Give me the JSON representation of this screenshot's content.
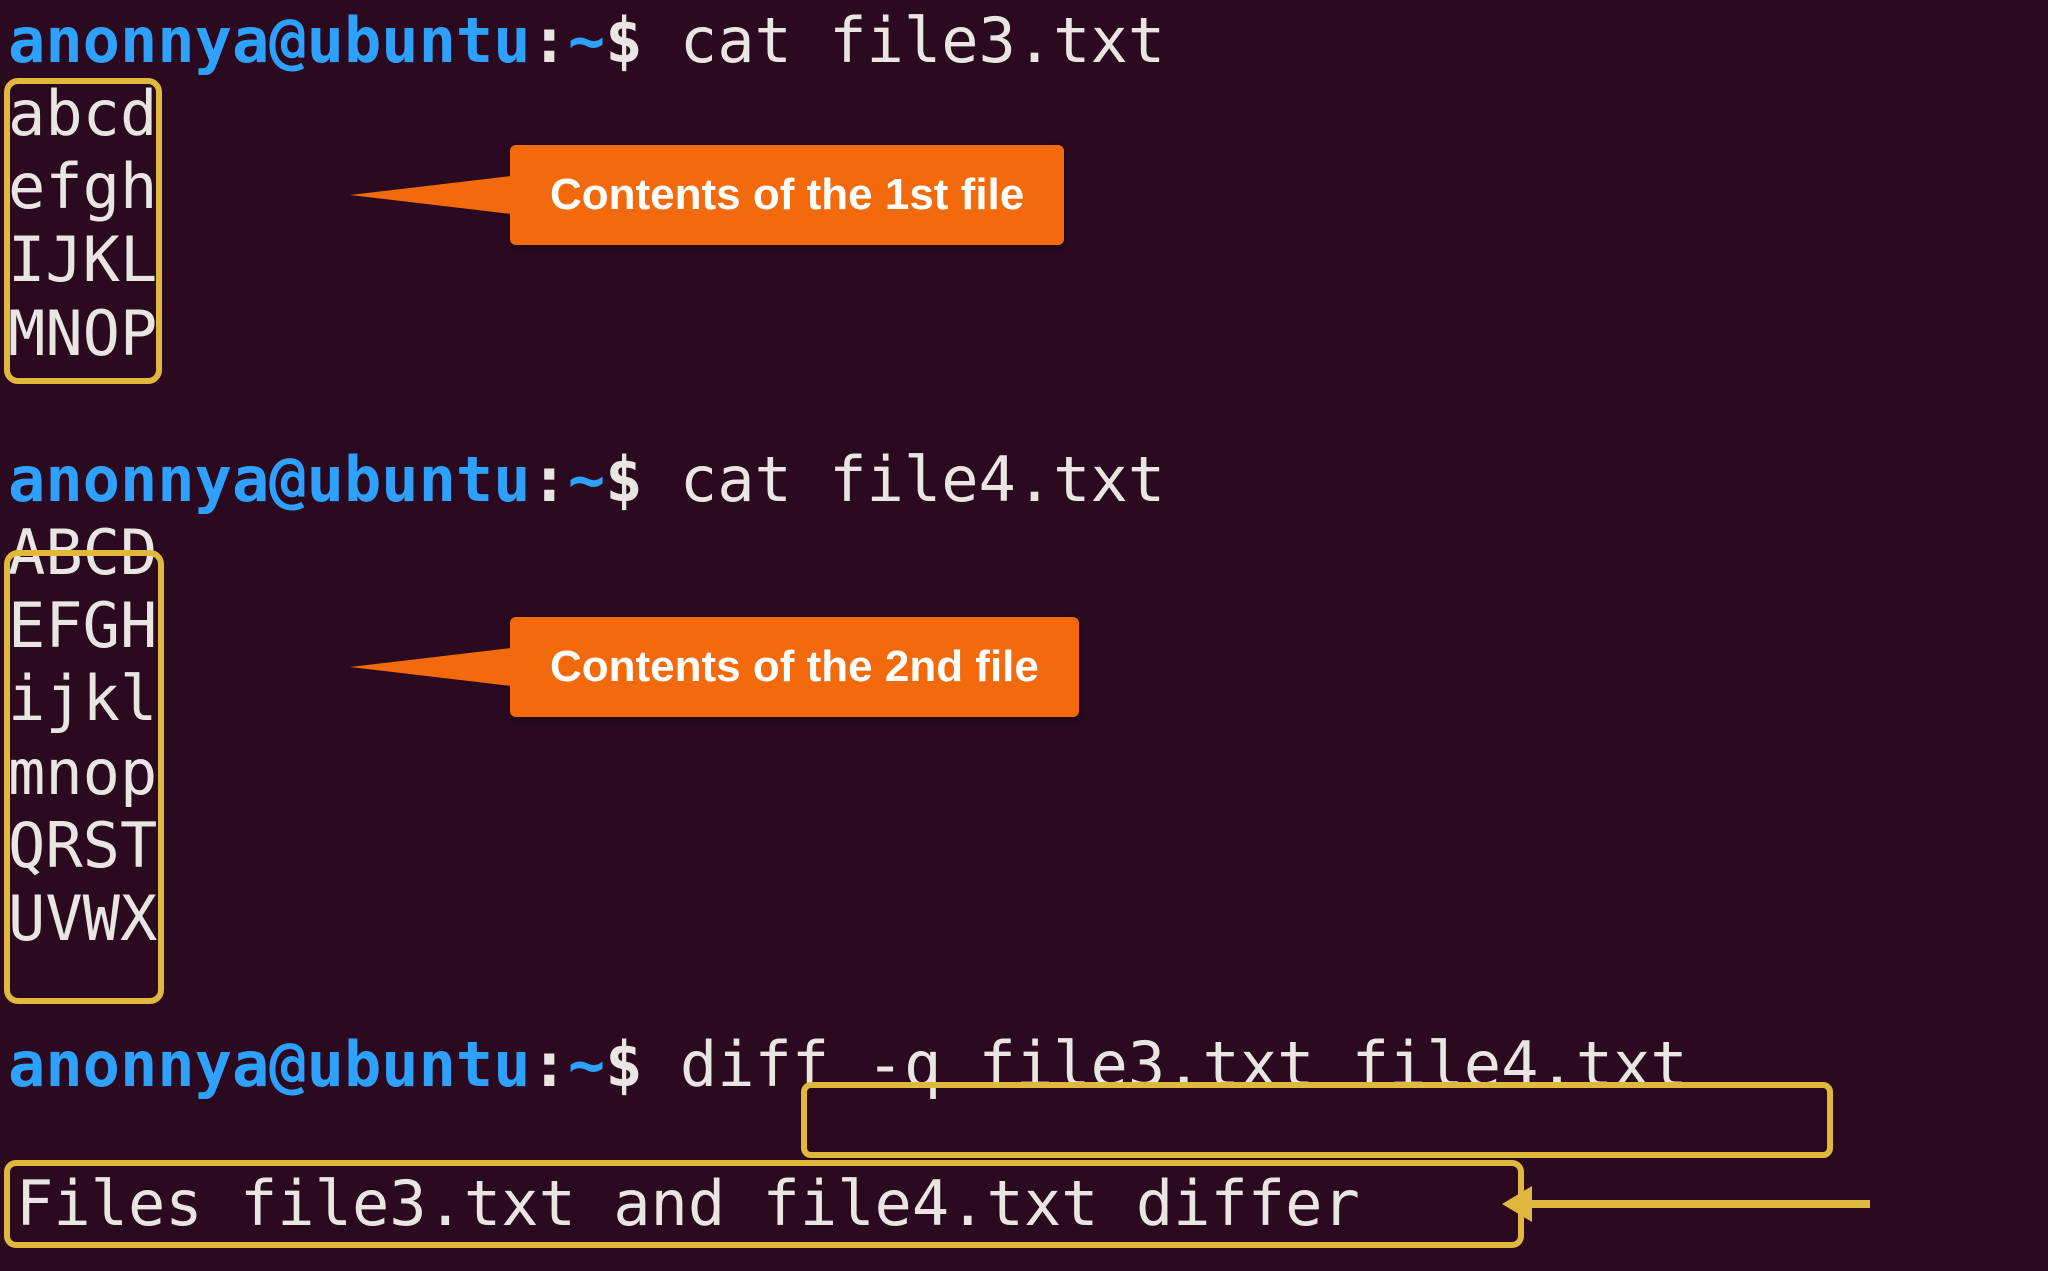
{
  "colors": {
    "background": "#2b0a1f",
    "prompt_user_host": "#2ea1ff",
    "text": "#e9e5e3",
    "highlight_border": "#e0b83e",
    "annotation_bg": "#f26a0b",
    "annotation_text": "#ffffff"
  },
  "prompt": {
    "user": "anonnya",
    "at": "@",
    "host": "ubuntu",
    "colon": ":",
    "path": "~",
    "symbol": "$"
  },
  "commands": {
    "cat1": "cat file3.txt",
    "cat2": "cat file4.txt",
    "diff_prefix": "diff ",
    "diff_args": "-q file3.txt file4.txt"
  },
  "file1_lines": [
    "abcd",
    "efgh",
    "IJKL",
    "MNOP"
  ],
  "file2_lines": [
    "ABCD",
    "EFGH",
    "ijkl",
    "mnop",
    "QRST",
    "UVWX"
  ],
  "diff_output": "Files file3.txt and file4.txt differ",
  "annotations": {
    "callout1": "Contents of the 1st file",
    "callout2": "Contents of the 2nd file"
  }
}
